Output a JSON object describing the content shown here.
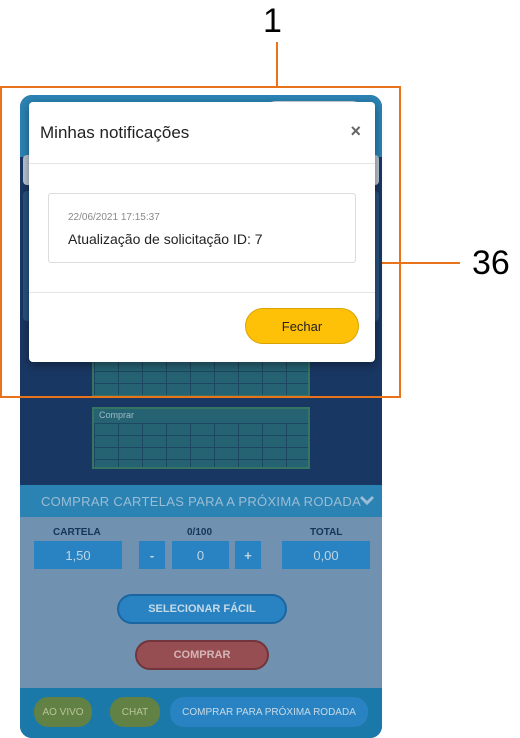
{
  "annotations": {
    "label_top": "1",
    "label_right": "36",
    "color": "#e8731a"
  },
  "modal": {
    "title": "Minhas notificações",
    "close_icon": "close-icon",
    "notification": {
      "date": "22/06/2021 17:15:37",
      "text": "Atualização de solicitação ID: 7"
    },
    "close_button": "Fechar"
  },
  "cards": [
    {
      "label": ""
    },
    {
      "label": "Comprar"
    }
  ],
  "buy_panel": {
    "header": "COMPRAR CARTELAS PARA A PRÓXIMA RODADA",
    "chevron_icon": "chevron-down-icon",
    "col_cartela": "CARTELA",
    "col_quantity": "0/100",
    "col_total": "TOTAL",
    "price_value": "1,50",
    "minus_label": "-",
    "quantity_value": "0",
    "plus_label": "+",
    "total_value": "0,00",
    "easy_select_button": "SELECIONAR FÁCIL",
    "buy_button": "COMPRAR"
  },
  "footer": {
    "live_button": "AO VIVO",
    "chat_button": "CHAT",
    "next_round_button": "COMPRAR PARA PRÓXIMA RODADA"
  },
  "colors": {
    "accent_yellow": "#ffc107",
    "app_dark_blue": "#1c3c6c",
    "app_light_blue": "#2f8fc4"
  }
}
